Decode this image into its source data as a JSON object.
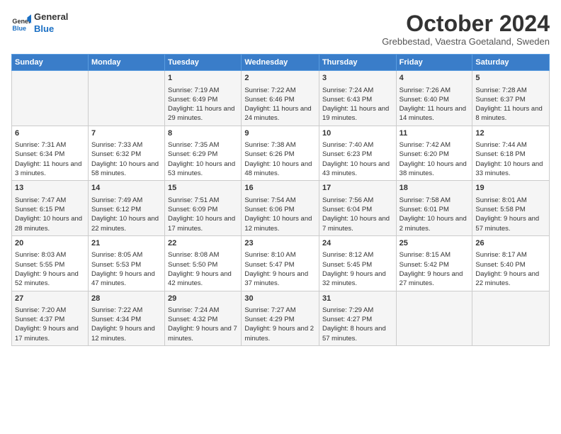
{
  "logo": {
    "line1": "General",
    "line2": "Blue"
  },
  "title": "October 2024",
  "subtitle": "Grebbestad, Vaestra Goetaland, Sweden",
  "headers": [
    "Sunday",
    "Monday",
    "Tuesday",
    "Wednesday",
    "Thursday",
    "Friday",
    "Saturday"
  ],
  "weeks": [
    [
      {
        "day": "",
        "content": ""
      },
      {
        "day": "",
        "content": ""
      },
      {
        "day": "1",
        "content": "Sunrise: 7:19 AM\nSunset: 6:49 PM\nDaylight: 11 hours and 29 minutes."
      },
      {
        "day": "2",
        "content": "Sunrise: 7:22 AM\nSunset: 6:46 PM\nDaylight: 11 hours and 24 minutes."
      },
      {
        "day": "3",
        "content": "Sunrise: 7:24 AM\nSunset: 6:43 PM\nDaylight: 11 hours and 19 minutes."
      },
      {
        "day": "4",
        "content": "Sunrise: 7:26 AM\nSunset: 6:40 PM\nDaylight: 11 hours and 14 minutes."
      },
      {
        "day": "5",
        "content": "Sunrise: 7:28 AM\nSunset: 6:37 PM\nDaylight: 11 hours and 8 minutes."
      }
    ],
    [
      {
        "day": "6",
        "content": "Sunrise: 7:31 AM\nSunset: 6:34 PM\nDaylight: 11 hours and 3 minutes."
      },
      {
        "day": "7",
        "content": "Sunrise: 7:33 AM\nSunset: 6:32 PM\nDaylight: 10 hours and 58 minutes."
      },
      {
        "day": "8",
        "content": "Sunrise: 7:35 AM\nSunset: 6:29 PM\nDaylight: 10 hours and 53 minutes."
      },
      {
        "day": "9",
        "content": "Sunrise: 7:38 AM\nSunset: 6:26 PM\nDaylight: 10 hours and 48 minutes."
      },
      {
        "day": "10",
        "content": "Sunrise: 7:40 AM\nSunset: 6:23 PM\nDaylight: 10 hours and 43 minutes."
      },
      {
        "day": "11",
        "content": "Sunrise: 7:42 AM\nSunset: 6:20 PM\nDaylight: 10 hours and 38 minutes."
      },
      {
        "day": "12",
        "content": "Sunrise: 7:44 AM\nSunset: 6:18 PM\nDaylight: 10 hours and 33 minutes."
      }
    ],
    [
      {
        "day": "13",
        "content": "Sunrise: 7:47 AM\nSunset: 6:15 PM\nDaylight: 10 hours and 28 minutes."
      },
      {
        "day": "14",
        "content": "Sunrise: 7:49 AM\nSunset: 6:12 PM\nDaylight: 10 hours and 22 minutes."
      },
      {
        "day": "15",
        "content": "Sunrise: 7:51 AM\nSunset: 6:09 PM\nDaylight: 10 hours and 17 minutes."
      },
      {
        "day": "16",
        "content": "Sunrise: 7:54 AM\nSunset: 6:06 PM\nDaylight: 10 hours and 12 minutes."
      },
      {
        "day": "17",
        "content": "Sunrise: 7:56 AM\nSunset: 6:04 PM\nDaylight: 10 hours and 7 minutes."
      },
      {
        "day": "18",
        "content": "Sunrise: 7:58 AM\nSunset: 6:01 PM\nDaylight: 10 hours and 2 minutes."
      },
      {
        "day": "19",
        "content": "Sunrise: 8:01 AM\nSunset: 5:58 PM\nDaylight: 9 hours and 57 minutes."
      }
    ],
    [
      {
        "day": "20",
        "content": "Sunrise: 8:03 AM\nSunset: 5:55 PM\nDaylight: 9 hours and 52 minutes."
      },
      {
        "day": "21",
        "content": "Sunrise: 8:05 AM\nSunset: 5:53 PM\nDaylight: 9 hours and 47 minutes."
      },
      {
        "day": "22",
        "content": "Sunrise: 8:08 AM\nSunset: 5:50 PM\nDaylight: 9 hours and 42 minutes."
      },
      {
        "day": "23",
        "content": "Sunrise: 8:10 AM\nSunset: 5:47 PM\nDaylight: 9 hours and 37 minutes."
      },
      {
        "day": "24",
        "content": "Sunrise: 8:12 AM\nSunset: 5:45 PM\nDaylight: 9 hours and 32 minutes."
      },
      {
        "day": "25",
        "content": "Sunrise: 8:15 AM\nSunset: 5:42 PM\nDaylight: 9 hours and 27 minutes."
      },
      {
        "day": "26",
        "content": "Sunrise: 8:17 AM\nSunset: 5:40 PM\nDaylight: 9 hours and 22 minutes."
      }
    ],
    [
      {
        "day": "27",
        "content": "Sunrise: 7:20 AM\nSunset: 4:37 PM\nDaylight: 9 hours and 17 minutes."
      },
      {
        "day": "28",
        "content": "Sunrise: 7:22 AM\nSunset: 4:34 PM\nDaylight: 9 hours and 12 minutes."
      },
      {
        "day": "29",
        "content": "Sunrise: 7:24 AM\nSunset: 4:32 PM\nDaylight: 9 hours and 7 minutes."
      },
      {
        "day": "30",
        "content": "Sunrise: 7:27 AM\nSunset: 4:29 PM\nDaylight: 9 hours and 2 minutes."
      },
      {
        "day": "31",
        "content": "Sunrise: 7:29 AM\nSunset: 4:27 PM\nDaylight: 8 hours and 57 minutes."
      },
      {
        "day": "",
        "content": ""
      },
      {
        "day": "",
        "content": ""
      }
    ]
  ]
}
